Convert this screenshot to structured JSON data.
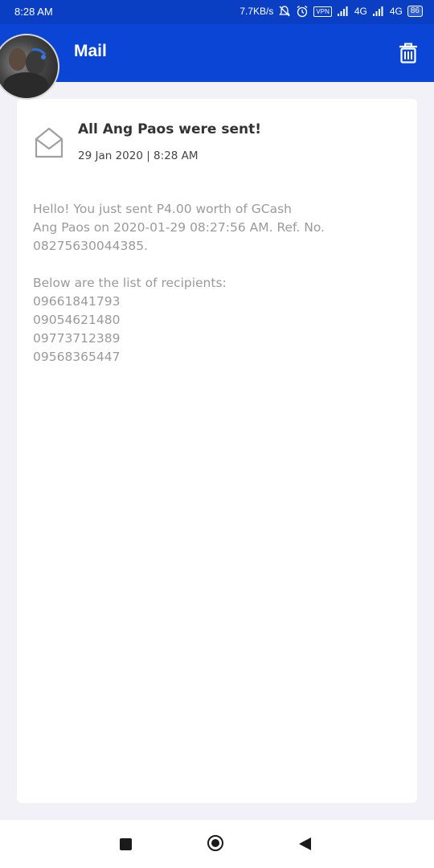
{
  "status_bar": {
    "time": "8:28 AM",
    "network_speed": "7.7KB/s",
    "vpn_label": "VPN",
    "network_1": "4G",
    "network_2": "4G",
    "battery": "86",
    "icons": [
      "mute-icon",
      "alarm-icon",
      "signal-icon",
      "signal-icon"
    ]
  },
  "app_bar": {
    "title": "Mail",
    "action_icon": "trash-icon",
    "avatar_icon": "avatar",
    "background_color": "#0b45d6"
  },
  "mail": {
    "icon": "envelope-open-icon",
    "title": "All Ang Paos were sent!",
    "date": "29 Jan 2020 | 8:28 AM",
    "body_lines": [
      "Hello! You just sent P4.00 worth of GCash",
      "Ang Paos on 2020-01-29 08:27:56 AM. Ref. No.",
      "08275630044385."
    ],
    "recipients_heading": "Below are the list of recipients:",
    "recipients": [
      "09661841793",
      "09054621480",
      "09773712389",
      "09568365447"
    ]
  },
  "nav_bar": {
    "icons": [
      "recent-apps-icon",
      "home-icon",
      "back-icon"
    ]
  }
}
